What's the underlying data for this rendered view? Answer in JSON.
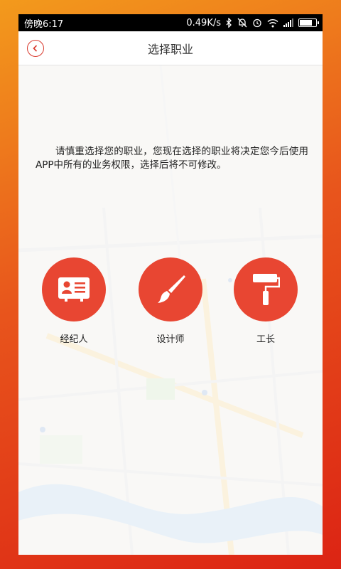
{
  "status_bar": {
    "time": "傍晚6:17",
    "net_speed": "0.49K/s",
    "icons": [
      "bluetooth-icon",
      "mute-icon",
      "alarm-icon",
      "wifi-icon",
      "signal-icon",
      "battery-icon"
    ]
  },
  "nav": {
    "back_icon": "chevron-left-icon",
    "title": "选择职业"
  },
  "notice": "请慎重选择您的职业，您现在选择的职业将决定您今后使用APP中所有的业务权限，选择后将不可修改。",
  "roles": [
    {
      "label": "经纪人",
      "icon": "id-card-icon"
    },
    {
      "label": "设计师",
      "icon": "paintbrush-icon"
    },
    {
      "label": "工长",
      "icon": "paint-roller-icon"
    }
  ],
  "colors": {
    "accent": "#e84632",
    "back_button": "#d9382c",
    "frame_top": "#f39a1c",
    "frame_bottom": "#dc2414"
  }
}
